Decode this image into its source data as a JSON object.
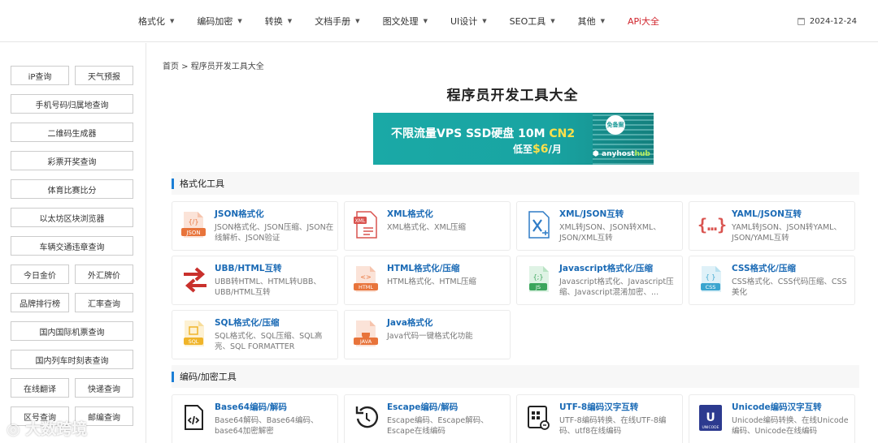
{
  "nav": {
    "items": [
      "格式化",
      "编码加密",
      "转换",
      "文档手册",
      "图文处理",
      "UI设计",
      "SEO工具",
      "其他"
    ],
    "api_label": "APi大全",
    "date": "2024-12-24"
  },
  "sidebar": {
    "items": [
      "iP查询",
      "天气预报",
      "手机号码归属地查询",
      "二维码生成器",
      "彩票开奖查询",
      "体育比赛比分",
      "以太坊区块浏览器",
      "车辆交通违章查询",
      "今日金价",
      "外汇牌价",
      "品牌排行榜",
      "汇率查询",
      "国内国际机票查询",
      "国内列车时刻表查询",
      "在线翻译",
      "快递查询",
      "区号查询",
      "邮编查询"
    ]
  },
  "breadcrumb": "首页 > 程序员开发工具大全",
  "page_title": "程序员开发工具大全",
  "banner": {
    "line1_prefix": "不限流量VPS SSD硬盘 10M ",
    "line1_highlight": "CN2",
    "line2_prefix": "低至",
    "line2_price": "$6",
    "line2_suffix": "/月",
    "stamp": "免备案",
    "brand_a": "anyhost",
    "brand_b": "hub"
  },
  "sections": [
    {
      "title": "格式化工具",
      "cards": [
        {
          "title": "JSON格式化",
          "desc": "JSON格式化、JSON压缩、JSON在线解析、JSON验证",
          "icon": "json-file-icon"
        },
        {
          "title": "XML格式化",
          "desc": "XML格式化、XML压缩",
          "icon": "xml-file-icon"
        },
        {
          "title": "XML/JSON互转",
          "desc": "XML转JSON、JSON转XML、JSON/XML互转",
          "icon": "excel-file-icon"
        },
        {
          "title": "YAML/JSON互转",
          "desc": "YAML转JSON、JSON转YAML、JSON/YAML互转",
          "icon": "braces-icon"
        },
        {
          "title": "UBB/HTML互转",
          "desc": "UBB转HTML、HTML转UBB、UBB/HTML互转",
          "icon": "swap-arrows-icon"
        },
        {
          "title": "HTML格式化/压缩",
          "desc": "HTML格式化、HTML压缩",
          "icon": "html-file-icon"
        },
        {
          "title": "Javascript格式化/压缩",
          "desc": "Javascript格式化、Javascript压缩、Javascript混淆加密、...",
          "icon": "js-file-icon"
        },
        {
          "title": "CSS格式化/压缩",
          "desc": "CSS格式化、CSS代码压缩、CSS美化",
          "icon": "css-file-icon"
        },
        {
          "title": "SQL格式化/压缩",
          "desc": "SQL格式化、SQL压缩、SQL高亮、SQL FORMATTER",
          "icon": "sql-file-icon"
        },
        {
          "title": "Java格式化",
          "desc": "Java代码一键格式化功能",
          "icon": "java-file-icon"
        }
      ]
    },
    {
      "title": "编码/加密工具",
      "cards": [
        {
          "title": "Base64编码/解码",
          "desc": "Base64解码、Base64编码、base64加密解密",
          "icon": "code-file-icon"
        },
        {
          "title": "Escape编码/解码",
          "desc": "Escape编码、Escape解码、Escape在线编码",
          "icon": "undo-circle-icon"
        },
        {
          "title": "UTF-8编码汉字互转",
          "desc": "UTF-8编码转换、在线UTF-8编码、utf8在线编码",
          "icon": "grid-file-icon"
        },
        {
          "title": "Unicode编码汉字互转",
          "desc": "Unicode编码转换、在线Unicode编码、Unicode在线编码",
          "icon": "unicode-icon"
        }
      ]
    }
  ],
  "watermark": "大数跨境"
}
